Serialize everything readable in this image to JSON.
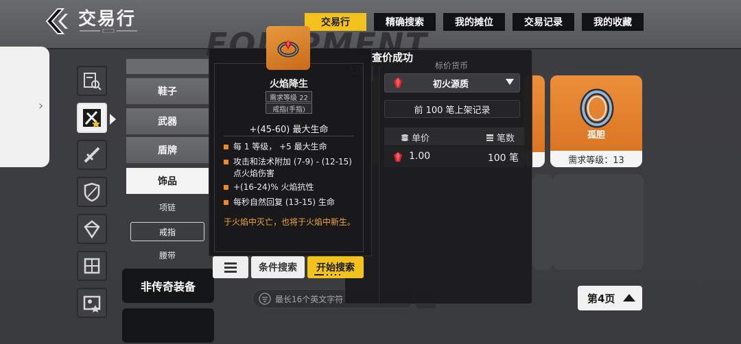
{
  "header": {
    "title": "交易行"
  },
  "tabs": [
    {
      "label": "交易行",
      "active": true
    },
    {
      "label": "精确搜索",
      "active": false
    },
    {
      "label": "我的摊位",
      "active": false
    },
    {
      "label": "交易记录",
      "active": false
    },
    {
      "label": "我的收藏",
      "active": false
    }
  ],
  "background": {
    "watermark": "EQUIPMENT"
  },
  "categories": {
    "icons": [
      "search-list-icon",
      "accessory-icon",
      "weapon-icon",
      "armor-icon",
      "gem-icon",
      "skill-icon",
      "map-icon"
    ],
    "active_index": 1
  },
  "subcategories": {
    "buttons": [
      "鞋子",
      "武器",
      "盾牌",
      "饰品"
    ],
    "active": "饰品",
    "items": [
      "项链",
      "戒指",
      "腰带"
    ],
    "selected_item": "戒指",
    "non_legendary": "非传奇装备"
  },
  "item": {
    "name": "火焰降生",
    "level_req": "需求等级 22",
    "type": "戒指(手指)",
    "main_stat": "+(45-60) 最大生命",
    "mods": [
      "每 1 等级， +5 最大生命",
      "攻击和法术附加 (7-9) - (12-15) 点火焰伤害",
      "+(16-24)% 火焰抗性",
      "每秒自然回复 (13-15) 生命"
    ],
    "flavor": "于火焰中灭亡，也将于火焰中新生。",
    "accent_color": "#ef8a1e",
    "flavor_color": "#f2a53a"
  },
  "actions": {
    "menu_icon": "menu-icon",
    "condition_search": "条件搜索",
    "start_search": "开始搜索"
  },
  "search": {
    "placeholder": "最长16个英文字符"
  },
  "price_popup": {
    "title": "查价成功",
    "currency_label": "标价货币",
    "currency": "初火源质",
    "records": "前 100 笔上架记录",
    "col_unit": "单价",
    "col_count": "笔数",
    "rows": [
      {
        "price": "1.00",
        "count": "100 笔"
      }
    ]
  },
  "grid": {
    "ring_name": "孤胆",
    "ring_level": "需求等级：13"
  },
  "pagination": {
    "label": "第4页"
  },
  "colors": {
    "accent_yellow": "#f4c21d",
    "card_orange": "#e3822e",
    "panel_dark": "#1c1c1f"
  }
}
